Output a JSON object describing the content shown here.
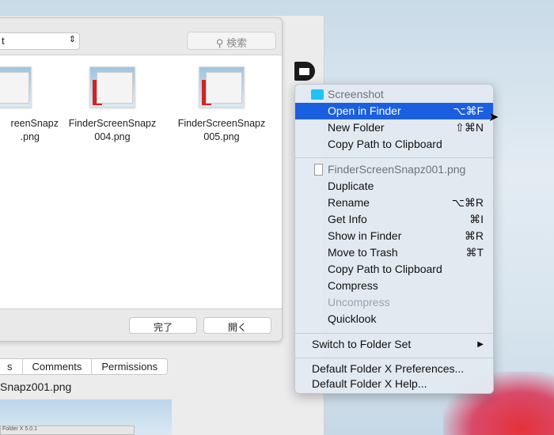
{
  "dialog": {
    "location_popup": "t",
    "search_placeholder": "検索",
    "files": [
      {
        "name_line1": "reenSnapz",
        "name_line2": ".png"
      },
      {
        "name_line1": "FinderScreenSnapz",
        "name_line2": "004.png"
      },
      {
        "name_line1": "FinderScreenSnapz",
        "name_line2": "005.png"
      }
    ],
    "done_button": "完了",
    "open_button": "開く"
  },
  "info_window": {
    "tabs": [
      "s",
      "Comments",
      "Permissions"
    ],
    "filename": "Snapz001.png",
    "preview_caption": "Folder X 5.0.1"
  },
  "menu": {
    "folder_header": "Screenshot",
    "folder_items": [
      {
        "label": "Open in Finder",
        "shortcut": "⌥⌘F"
      },
      {
        "label": "New Folder",
        "shortcut": "⇧⌘N"
      },
      {
        "label": "Copy Path to Clipboard",
        "shortcut": ""
      }
    ],
    "file_header": "FinderScreenSnapz001.png",
    "file_items": [
      {
        "label": "Duplicate",
        "shortcut": ""
      },
      {
        "label": "Rename",
        "shortcut": "⌥⌘R"
      },
      {
        "label": "Get Info",
        "shortcut": "⌘I"
      },
      {
        "label": "Show in Finder",
        "shortcut": "⌘R"
      },
      {
        "label": "Move to Trash",
        "shortcut": "⌘T"
      },
      {
        "label": "Copy Path to Clipboard",
        "shortcut": ""
      },
      {
        "label": "Compress",
        "shortcut": ""
      },
      {
        "label": "Uncompress",
        "shortcut": ""
      },
      {
        "label": "Quicklook",
        "shortcut": ""
      }
    ],
    "switch_folder_set": "Switch to Folder Set",
    "preferences": "Default Folder X Preferences...",
    "help": "Default Folder X Help...",
    "highlight_color": "#1a5fe0"
  }
}
